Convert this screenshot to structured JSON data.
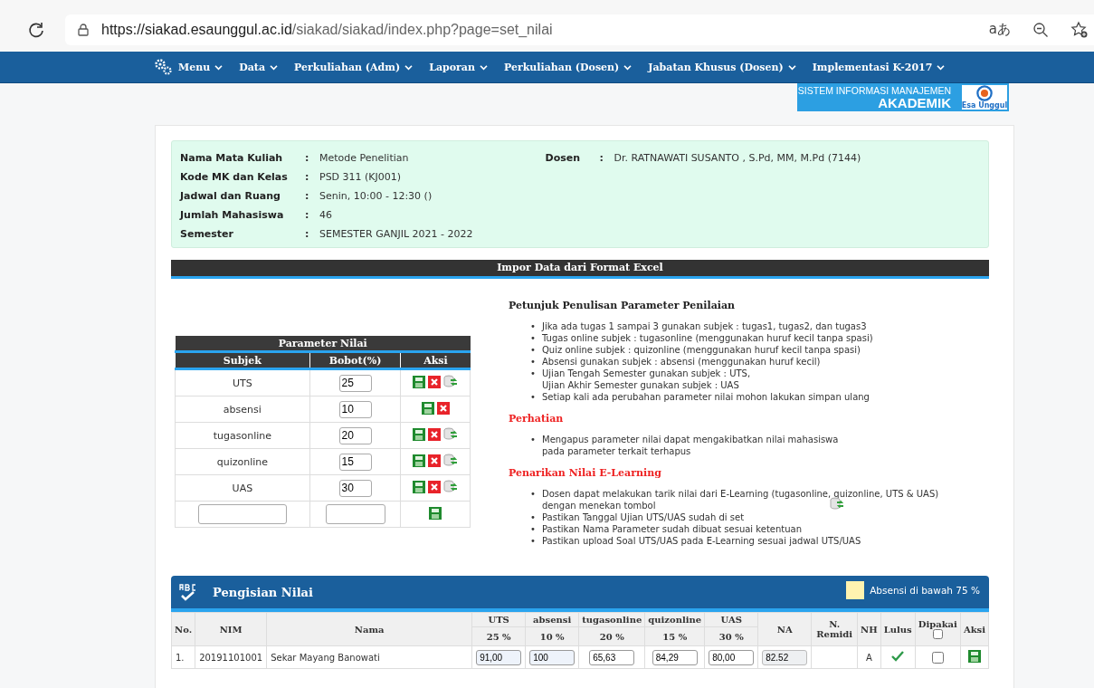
{
  "browser": {
    "url_host": "https://siakad.esaunggul.ac.id",
    "url_path": "/siakad/siakad/index.php?page=set_nilai",
    "translate_glyph": "aあ"
  },
  "nav": {
    "items": [
      {
        "label": "Menu",
        "kind": "gear"
      },
      {
        "label": "Data",
        "kind": "plain"
      },
      {
        "label": "Perkuliahan (Adm)",
        "kind": "plain"
      },
      {
        "label": "Laporan",
        "kind": "plain"
      },
      {
        "label": "Perkuliahan (Dosen)",
        "kind": "plain"
      },
      {
        "label": "Jabatan Khusus (Dosen)",
        "kind": "plain"
      },
      {
        "label": "Implementasi K-2017",
        "kind": "plain"
      }
    ],
    "logo": {
      "line1": "SISTEM INFORMASI MANAJEMEN",
      "line2": "AKADEMIK",
      "badge": "Esa Unggul"
    }
  },
  "course_info": {
    "rows": [
      {
        "label": "Nama Mata Kuliah",
        "value": "Metode Penelitian"
      },
      {
        "label": "Kode MK dan Kelas",
        "value": "PSD 311 (KJ001)"
      },
      {
        "label": "Jadwal dan Ruang",
        "value": "Senin, 10:00 - 12:30 ()"
      },
      {
        "label": "Jumlah Mahasiswa",
        "value": "46"
      },
      {
        "label": "Semester",
        "value": "SEMESTER GANJIL 2021 - 2022"
      }
    ],
    "lecturer": {
      "label": "Dosen",
      "value": "Dr. RATNAWATI SUSANTO , S.Pd, MM, M.Pd (7144)"
    },
    "separator": ":"
  },
  "import_bar": {
    "title": "Impor Data dari Format Excel"
  },
  "parameter_table": {
    "title": "Parameter Nilai",
    "columns": [
      "Subjek",
      "Bobot(%)",
      "Aksi"
    ],
    "rows": [
      {
        "subject": "UTS",
        "weight": "25",
        "actions": [
          {
            "kind": "save"
          },
          {
            "kind": "delete"
          },
          {
            "kind": "sync"
          }
        ]
      },
      {
        "subject": "absensi",
        "weight": "10",
        "actions": [
          {
            "kind": "save"
          },
          {
            "kind": "delete"
          }
        ]
      },
      {
        "subject": "tugasonline",
        "weight": "20",
        "actions": [
          {
            "kind": "save"
          },
          {
            "kind": "delete"
          },
          {
            "kind": "sync"
          }
        ]
      },
      {
        "subject": "quizonline",
        "weight": "15",
        "actions": [
          {
            "kind": "save"
          },
          {
            "kind": "delete"
          },
          {
            "kind": "sync"
          }
        ]
      },
      {
        "subject": "UAS",
        "weight": "30",
        "actions": [
          {
            "kind": "save"
          },
          {
            "kind": "delete"
          },
          {
            "kind": "sync"
          }
        ]
      }
    ],
    "new_row_actions": [
      {
        "kind": "save"
      }
    ]
  },
  "bullet": "•",
  "guide": {
    "title": "Petunjuk Penulisan Parameter Penilaian",
    "items": [
      {
        "lines": [
          "Jika ada tugas 1 sampai 3 gunakan subjek : tugas1, tugas2, dan tugas3"
        ]
      },
      {
        "lines": [
          "Tugas online subjek : tugasonline (menggunakan huruf kecil tanpa spasi)"
        ]
      },
      {
        "lines": [
          "Quiz online subjek : quizonline (menggunakan huruf kecil tanpa spasi)"
        ]
      },
      {
        "lines": [
          "Absensi gunakan subjek : absensi (menggunakan huruf kecil)"
        ]
      },
      {
        "lines": [
          "Ujian Tengah Semester gunakan subjek : UTS,",
          "Ujian Akhir Semester gunakan subjek : UAS"
        ]
      },
      {
        "lines": [
          "Setiap kali ada perubahan parameter nilai mohon lakukan simpan ulang"
        ]
      }
    ]
  },
  "warning": {
    "title": "Perhatian",
    "items": [
      {
        "lines": [
          "Mengapus parameter nilai dapat mengakibatkan nilai mahasiswa",
          "pada parameter terkait terhapus"
        ]
      }
    ]
  },
  "elearning": {
    "title": "Penarikan Nilai E-Learning",
    "items": [
      {
        "lines": [
          "Dosen dapat melakukan tarik nilai dari E-Learning (tugasonline, quizonline, UTS & UAS)",
          "dengan menekan tombol"
        ],
        "icon": true
      },
      {
        "lines": [
          "Pastikan Tanggal Ujian UTS/UAS sudah di set"
        ],
        "icon": false
      },
      {
        "lines": [
          "Pastikan Nama Parameter sudah dibuat sesuai ketentuan"
        ],
        "icon": false
      },
      {
        "lines": [
          "Pastikan upload Soal UTS/UAS pada E-Learning sesuai jadwal UTS/UAS"
        ],
        "icon": false
      }
    ]
  },
  "grading": {
    "title": "Pengisian Nilai",
    "legend": {
      "label": "Absensi di bawah 75 %",
      "color": "#fff3b0"
    },
    "columns": {
      "no": "No.",
      "nim": "NIM",
      "nama": "Nama",
      "scores": [
        {
          "name": "UTS",
          "weight": "25 %"
        },
        {
          "name": "absensi",
          "weight": "10 %"
        },
        {
          "name": "tugasonline",
          "weight": "20 %"
        },
        {
          "name": "quizonline",
          "weight": "15 %"
        },
        {
          "name": "UAS",
          "weight": "30 %"
        }
      ],
      "na": "NA",
      "remidi": "N. Remidi",
      "nh": "NH",
      "lulus": "Lulus",
      "dipakai": "Dipakai",
      "aksi": "Aksi"
    },
    "select_all_checked": false,
    "rows": [
      {
        "no": "1.",
        "nim": "20191101001",
        "nama": "Sekar Mayang Banowati",
        "scores": [
          {
            "value": "91,00",
            "highlighted": true
          },
          {
            "value": "100",
            "highlighted": true
          },
          {
            "value": "65,63",
            "highlighted": false
          },
          {
            "value": "84,29",
            "highlighted": false
          },
          {
            "value": "80,00",
            "highlighted": false
          }
        ],
        "na": "82.52",
        "nh": "A",
        "passed": true,
        "used_checked": false
      }
    ]
  }
}
